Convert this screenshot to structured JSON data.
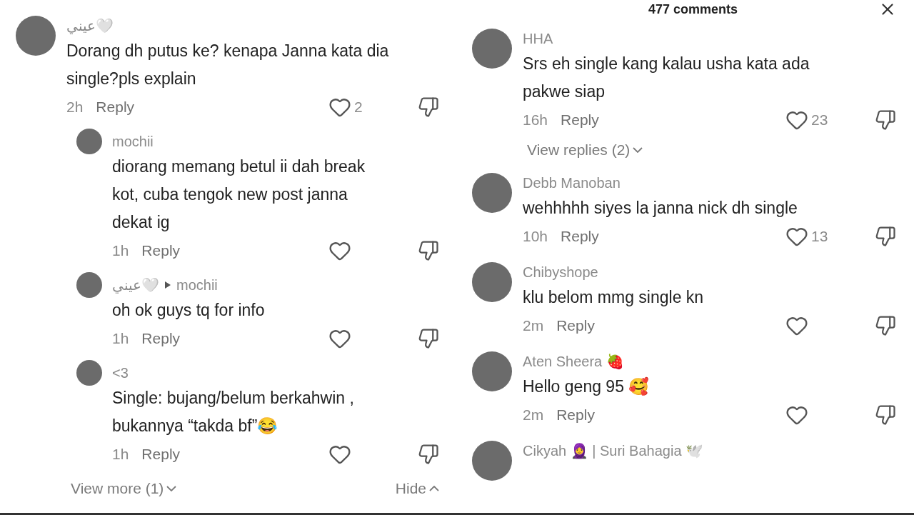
{
  "left": {
    "comments": [
      {
        "author": "عيني🤍",
        "text": "Dorang dh putus ke? kenapa Janna kata dia single?pls explain",
        "time": "2h",
        "reply": "Reply",
        "likes": "2",
        "replies": [
          {
            "author": "mochii",
            "text": "diorang memang betul ii dah break kot, cuba tengok new post janna dekat ig",
            "time": "1h",
            "reply": "Reply"
          },
          {
            "author": "عيني🤍",
            "reply_to": "mochii",
            "text": "oh ok guys tq for info",
            "time": "1h",
            "reply": "Reply"
          },
          {
            "author": "<3",
            "text": "Single: bujang/belum berkahwin , bukannya “takda bf”😂",
            "time": "1h",
            "reply": "Reply"
          }
        ]
      }
    ],
    "view_more": "View more (1)",
    "hide": "Hide"
  },
  "right": {
    "title": "477 comments",
    "comments": [
      {
        "author": "HHA",
        "text": "Srs eh single kang kalau usha kata ada pakwe siap",
        "time": "16h",
        "reply": "Reply",
        "likes": "23",
        "view_replies": "View replies (2)"
      },
      {
        "author": "Debb Manoban",
        "text": "wehhhhh siyes la janna nick dh single",
        "time": "10h",
        "reply": "Reply",
        "likes": "13"
      },
      {
        "author": "Chibyshope",
        "text": "klu belom mmg single kn",
        "time": "2m",
        "reply": "Reply"
      },
      {
        "author": "Aten Sheera 🍓",
        "text": "Hello geng 95 🥰",
        "time": "2m",
        "reply": "Reply"
      },
      {
        "author": "Cikyah 🧕 | Suri Bahagia 🕊️"
      }
    ]
  }
}
